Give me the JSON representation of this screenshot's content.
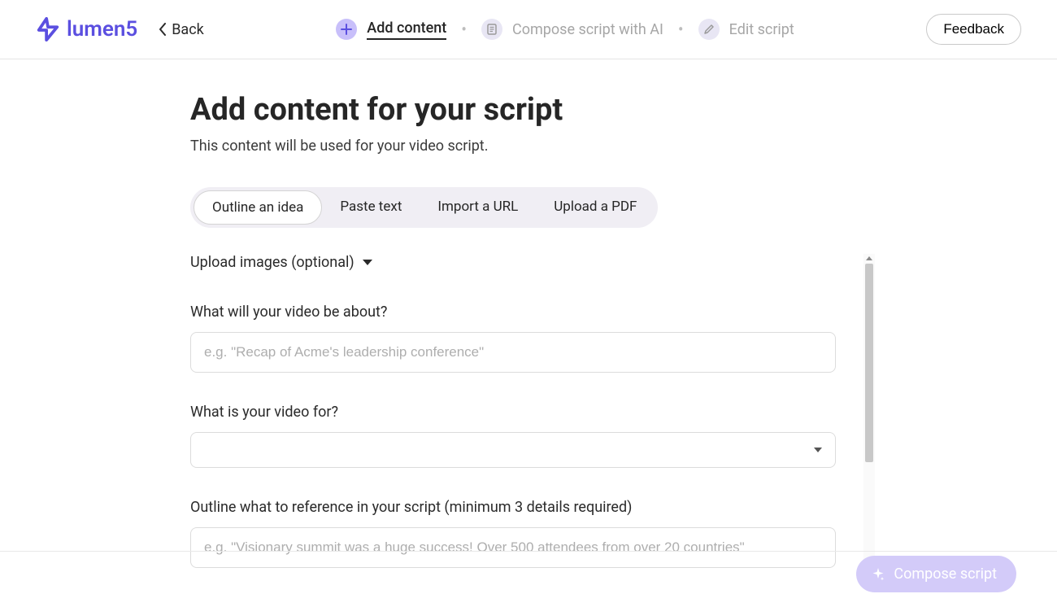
{
  "header": {
    "brand": "lumen5",
    "back_label": "Back",
    "feedback_label": "Feedback",
    "steps": [
      {
        "label": "Add content"
      },
      {
        "label": "Compose script with AI"
      },
      {
        "label": "Edit script"
      }
    ]
  },
  "page": {
    "title": "Add content for your script",
    "subtitle": "This content will be used for your video script."
  },
  "tabs": [
    {
      "label": "Outline an idea",
      "active": true
    },
    {
      "label": "Paste text",
      "active": false
    },
    {
      "label": "Import a URL",
      "active": false
    },
    {
      "label": "Upload a PDF",
      "active": false
    }
  ],
  "form": {
    "upload_images_label": "Upload images (optional)",
    "about_label": "What will your video be about?",
    "about_placeholder": "e.g. \"Recap of Acme's leadership conference\"",
    "about_value": "",
    "for_label": "What is your video for?",
    "for_value": "",
    "outline_label": "Outline what to reference in your script (minimum 3 details required)",
    "outline_placeholder": "e.g. \"Visionary summit was a huge success! Over 500 attendees from over 20 countries\"",
    "outline_value": ""
  },
  "footer": {
    "compose_label": "Compose script"
  }
}
